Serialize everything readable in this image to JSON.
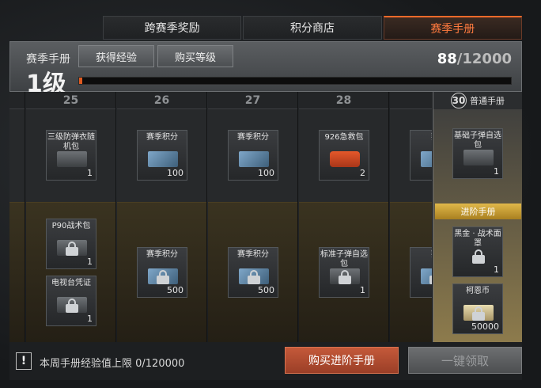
{
  "tabs": [
    {
      "label": "跨赛季奖励",
      "active": false
    },
    {
      "label": "积分商店",
      "active": false
    },
    {
      "label": "赛季手册",
      "active": true
    }
  ],
  "header": {
    "title": "赛季手册",
    "level": "1级",
    "earn_exp_label": "获得经验",
    "buy_level_label": "购买等级",
    "exp_current": "88",
    "exp_total": "/12000",
    "progress_fraction": 0.0073
  },
  "levels": [
    {
      "level": "25",
      "free": [
        {
          "name": "三级防弹衣随机包",
          "qty": "1",
          "pic": "box"
        }
      ],
      "adv": [
        {
          "name": "P90战术包",
          "qty": "1",
          "pic": "box"
        },
        {
          "name": "电视台凭证",
          "qty": "1",
          "pic": "box"
        }
      ]
    },
    {
      "level": "26",
      "free": [
        {
          "name": "赛季积分",
          "qty": "100",
          "pic": "ticket"
        }
      ],
      "adv": [
        {
          "name": "赛季积分",
          "qty": "500",
          "pic": "ticket"
        }
      ]
    },
    {
      "level": "27",
      "free": [
        {
          "name": "赛季积分",
          "qty": "100",
          "pic": "ticket"
        }
      ],
      "adv": [
        {
          "name": "赛季积分",
          "qty": "500",
          "pic": "ticket"
        }
      ]
    },
    {
      "level": "28",
      "free": [
        {
          "name": "926急救包",
          "qty": "2",
          "pic": "kit"
        }
      ],
      "adv": [
        {
          "name": "标准子弹自选包",
          "qty": "1",
          "pic": "box"
        }
      ]
    },
    {
      "level": "",
      "free": [
        {
          "name": "赛",
          "qty": "",
          "pic": "ticket"
        }
      ],
      "adv": [
        {
          "name": "赛",
          "qty": "",
          "pic": "ticket"
        }
      ]
    }
  ],
  "side": {
    "level": "30",
    "free_label": "普通手册",
    "adv_label": "进阶手册",
    "free_item": {
      "name": "基础子弹自选包",
      "qty": "1"
    },
    "adv_items": [
      {
        "name": "黑金 · 战术面罩",
        "qty": "1"
      },
      {
        "name": "柯恩币",
        "qty": "50000"
      }
    ]
  },
  "footer": {
    "notice": "本周手册经验值上限 0/120000",
    "buy_label": "购买进阶手册",
    "claim_label": "一键领取"
  },
  "icons": {
    "warning": "warning-icon",
    "lock": "lock-icon"
  },
  "colors": {
    "accent": "#ff6a2a",
    "gold": "#e0b84a"
  }
}
